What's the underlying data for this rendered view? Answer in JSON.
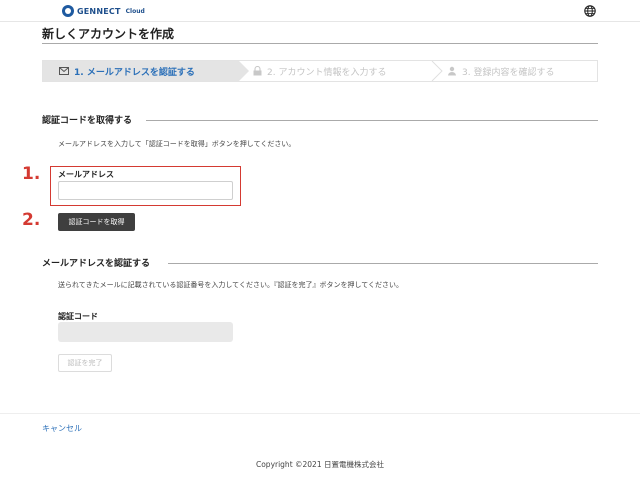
{
  "header": {
    "logo_text": "GENNECT",
    "logo_sub": "Cloud",
    "language_icon": "globe-icon"
  },
  "page": {
    "title": "新しくアカウントを作成"
  },
  "steps": [
    {
      "label": "1. メールアドレスを認証する",
      "icon": "envelope-icon",
      "state": "active"
    },
    {
      "label": "2. アカウント情報を入力する",
      "icon": "lock-icon",
      "state": "inactive"
    },
    {
      "label": "3. 登録内容を確認する",
      "icon": "user-shield-icon",
      "state": "inactive"
    }
  ],
  "get_code": {
    "heading": "認証コードを取得する",
    "description": "メールアドレスを入力して「認証コードを取得」ボタンを押してください。",
    "email_label": "メールアドレス",
    "email_value": "",
    "email_placeholder": "",
    "button_label": "認証コードを取得"
  },
  "verify": {
    "heading": "メールアドレスを認証する",
    "description": "送られてきたメールに記載されている認証番号を入力してください。『認証を完了』ボタンを押してください。",
    "code_label": "認証コード",
    "code_value": "",
    "code_placeholder": "",
    "button_label": "認証を完了"
  },
  "annotations": {
    "marker_1": "1.",
    "marker_2": "2."
  },
  "footer": {
    "cancel_label": "キャンセル",
    "copyright": "Copyright ©2021 日置電機株式会社"
  },
  "colors": {
    "accent": "#2a6fb8",
    "annotation": "#d43a32",
    "button_dark": "#3f3f3f"
  }
}
